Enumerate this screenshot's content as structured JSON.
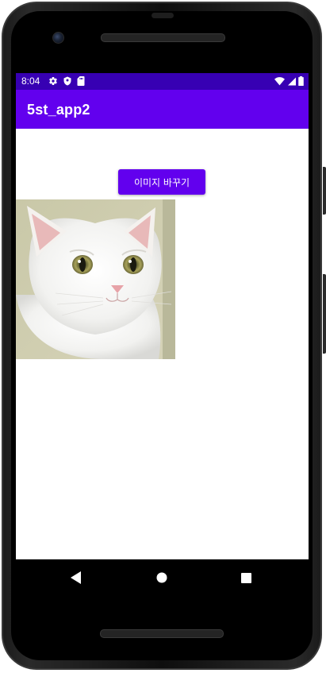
{
  "status_bar": {
    "time": "8:04",
    "icons_left": [
      "gear-icon",
      "shield-icon",
      "sd-card-icon"
    ],
    "icons_right": [
      "wifi-icon",
      "signal-icon",
      "battery-icon"
    ],
    "color": "#3700b3"
  },
  "app_bar": {
    "title": "5st_app2",
    "color": "#6200ee"
  },
  "main": {
    "change_image_button_label": "이미지 바꾸기",
    "image": {
      "subject": "white cat",
      "icon_name": "cat-photo"
    }
  },
  "nav_bar": {
    "buttons": [
      "back-icon",
      "home-icon",
      "recents-icon"
    ]
  },
  "colors": {
    "primary": "#6200ee",
    "primary_dark": "#3700b3",
    "text_on_primary": "#ffffff"
  }
}
